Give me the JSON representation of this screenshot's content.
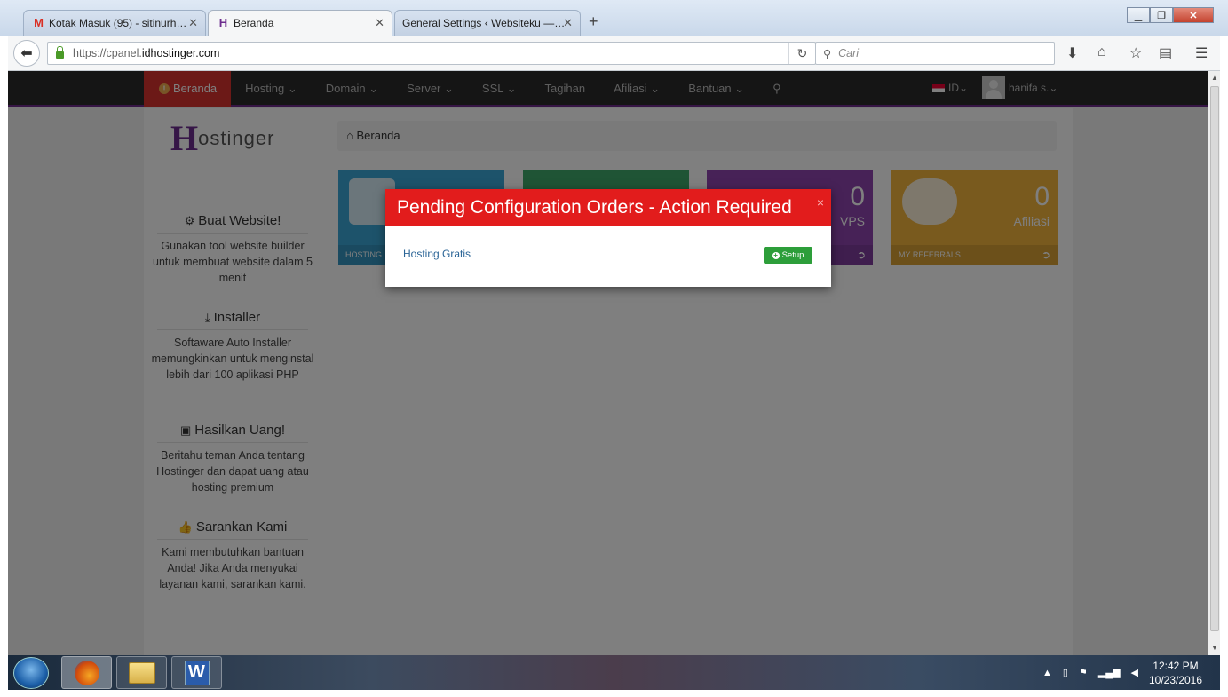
{
  "browser": {
    "tabs": [
      {
        "label": "Kotak Masuk (95) - sitinurh…",
        "icon": "gmail-icon",
        "active": false
      },
      {
        "label": "Beranda",
        "icon": "hostinger-icon",
        "active": true
      },
      {
        "label": "General Settings ‹ Websiteku —…",
        "icon": "",
        "active": false
      }
    ],
    "new_tab": "+",
    "url_prefix": "https://cpanel.",
    "url_domain": "idhostinger.com",
    "search_placeholder": "Cari"
  },
  "site": {
    "menu": [
      "Beranda",
      "Hosting",
      "Domain",
      "Server",
      "SSL",
      "Tagihan",
      "Afiliasi",
      "Bantuan"
    ],
    "caret": "⌄",
    "language": "ID",
    "username": "hanifa s.",
    "logo_text": "ostinger",
    "sidebar": [
      {
        "title": "Buat Website!",
        "icon": "gears-icon",
        "text": "Gunakan tool website builder untuk membuat website dalam 5 menit"
      },
      {
        "title": "Installer",
        "icon": "download-icon",
        "text": "Softaware Auto Installer memungkinkan untuk menginstal lebih dari 100 aplikasi PHP"
      },
      {
        "title": "Hasilkan Uang!",
        "icon": "money-icon",
        "text": "Beritahu teman Anda tentang Hostinger dan dapat uang atau hosting premium"
      },
      {
        "title": "Sarankan Kami",
        "icon": "thumbs-up-icon",
        "text": "Kami membutuhkan bantuan Anda! Jika Anda menyukai layanan kami, sarankan kami."
      }
    ],
    "breadcrumb": "Beranda",
    "cards": [
      {
        "color": "#3aa6d6",
        "number": "",
        "label": "",
        "footer": "HOSTING"
      },
      {
        "color": "#3fa86a",
        "number": "",
        "label": "",
        "footer": ""
      },
      {
        "color": "#8e45ae",
        "number": "0",
        "label": "VPS",
        "footer": ""
      },
      {
        "color": "#f2b43c",
        "number": "0",
        "label": "Afiliasi",
        "footer": "MY REFERRALS"
      }
    ]
  },
  "modal": {
    "title": "Pending Configuration Orders - Action Required",
    "close": "×",
    "item": "Hosting Gratis",
    "button": "Setup"
  },
  "taskbar": {
    "time": "12:42 PM",
    "date": "10/23/2016"
  }
}
